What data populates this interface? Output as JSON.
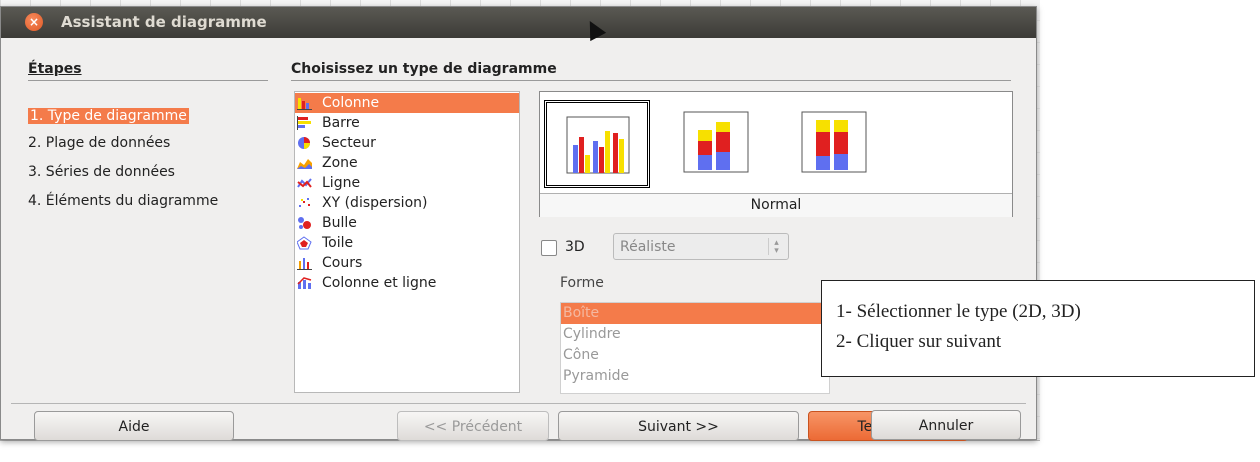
{
  "window": {
    "title": "Assistant de diagramme",
    "close_glyph": "×"
  },
  "steps": {
    "heading": "Étapes",
    "items": [
      {
        "label": "1. Type de diagramme",
        "active": true
      },
      {
        "label": "2. Plage de données",
        "active": false
      },
      {
        "label": "3. Séries de données",
        "active": false
      },
      {
        "label": "4. Éléments du diagramme",
        "active": false
      }
    ]
  },
  "chart_types": {
    "heading": "Choisissez un type de diagramme",
    "items": [
      {
        "label": "Colonne",
        "icon": "column-chart-icon",
        "selected": true
      },
      {
        "label": "Barre",
        "icon": "bar-chart-icon",
        "selected": false
      },
      {
        "label": "Secteur",
        "icon": "pie-chart-icon",
        "selected": false
      },
      {
        "label": "Zone",
        "icon": "area-chart-icon",
        "selected": false
      },
      {
        "label": "Ligne",
        "icon": "line-chart-icon",
        "selected": false
      },
      {
        "label": "XY (dispersion)",
        "icon": "scatter-chart-icon",
        "selected": false
      },
      {
        "label": "Bulle",
        "icon": "bubble-chart-icon",
        "selected": false
      },
      {
        "label": "Toile",
        "icon": "net-chart-icon",
        "selected": false
      },
      {
        "label": "Cours",
        "icon": "stock-chart-icon",
        "selected": false
      },
      {
        "label": "Colonne et ligne",
        "icon": "column-line-chart-icon",
        "selected": false
      }
    ]
  },
  "variants": {
    "items": [
      {
        "name": "normal",
        "selected": true
      },
      {
        "name": "stacked",
        "selected": false
      },
      {
        "name": "percent-stacked",
        "selected": false
      }
    ],
    "caption": "Normal"
  },
  "three_d": {
    "label": "3D",
    "checked": false,
    "select_value": "Réaliste"
  },
  "shape": {
    "label": "Forme",
    "items": [
      {
        "label": "Boîte",
        "selected": true
      },
      {
        "label": "Cylindre",
        "selected": false
      },
      {
        "label": "Cône",
        "selected": false
      },
      {
        "label": "Pyramide",
        "selected": false
      }
    ]
  },
  "callout": {
    "line1": "1- Sélectionner le type (2D, 3D)",
    "line2": "2- Cliquer sur suivant"
  },
  "buttons": {
    "help": "Aide",
    "previous": "<< Précédent",
    "next": "Suivant >>",
    "finish": "Terminer",
    "cancel": "Annuler"
  },
  "colors": {
    "accent": "#f47b4a",
    "titlebar": "#3c3b37",
    "bar_blue": "#5f6ff0",
    "bar_red": "#e02020",
    "bar_yellow": "#f7e000"
  }
}
